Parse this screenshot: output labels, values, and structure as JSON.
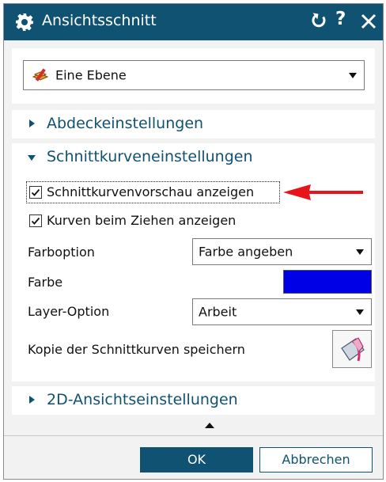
{
  "window": {
    "title": "Ansichtsschnitt",
    "icon": "gear-icon"
  },
  "titlebar_actions": {
    "reset_icon": "reset-icon",
    "help_label": "?",
    "close_icon": "close-icon"
  },
  "type_select": {
    "value": "Eine Ebene",
    "icon": "plane-icon"
  },
  "sections": {
    "cover": {
      "label": "Abdeckeinstellungen",
      "expanded": false
    },
    "section_curves": {
      "label": "Schnittkurveneinstellungen",
      "expanded": true
    },
    "view_2d": {
      "label": "2D-Ansichtseinstellungen",
      "expanded": false
    }
  },
  "section_curves": {
    "preview_checkbox": {
      "label": "Schnittkurvenvorschau anzeigen",
      "checked": true
    },
    "drag_checkbox": {
      "label": "Kurven beim Ziehen anzeigen",
      "checked": true
    },
    "color_option": {
      "label": "Farboption",
      "value": "Farbe angeben"
    },
    "color": {
      "label": "Farbe",
      "value": "#0000e6"
    },
    "layer_option": {
      "label": "Layer-Option",
      "value": "Arbeit"
    },
    "save_copy": {
      "label": "Kopie der Schnittkurven speichern",
      "icon": "save-curves-icon"
    }
  },
  "annotation": {
    "type": "arrow",
    "color": "#e8141b"
  },
  "buttons": {
    "ok": "OK",
    "cancel": "Abbrechen"
  },
  "colors": {
    "accent": "#0f5272",
    "background": "#f2f2f2"
  }
}
